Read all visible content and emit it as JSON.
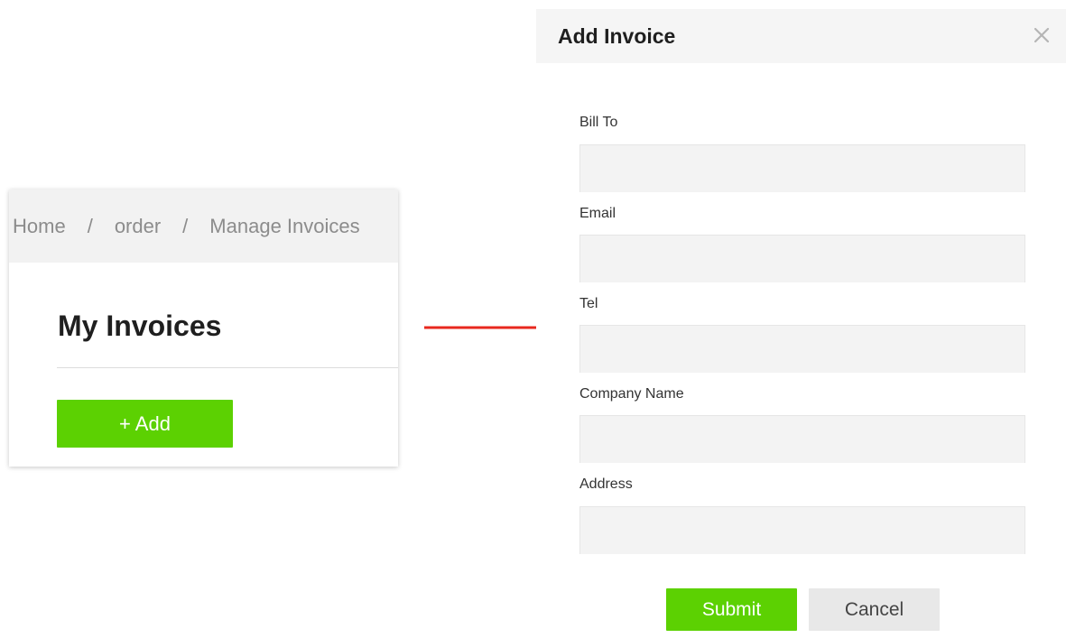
{
  "breadcrumb": {
    "items": [
      "Home",
      "order",
      "Manage Invoices"
    ],
    "separator": "/"
  },
  "page": {
    "title": "My Invoices",
    "add_button_label": "+ Add"
  },
  "modal": {
    "title": "Add Invoice",
    "close_icon": "close-icon",
    "fields": [
      {
        "label": "Bill To",
        "value": "",
        "placeholder": ""
      },
      {
        "label": "Email",
        "value": "",
        "placeholder": ""
      },
      {
        "label": "Tel",
        "value": "",
        "placeholder": ""
      },
      {
        "label": "Company Name",
        "value": "",
        "placeholder": ""
      },
      {
        "label": "Address",
        "value": "",
        "placeholder": ""
      }
    ],
    "submit_label": "Submit",
    "cancel_label": "Cancel"
  },
  "colors": {
    "accent_green": "#5cd102",
    "arrow_red": "#e8281e",
    "breadcrumb_bg": "#f2f2f2",
    "input_bg": "#f3f3f3",
    "cancel_bg": "#e8e8e8"
  }
}
